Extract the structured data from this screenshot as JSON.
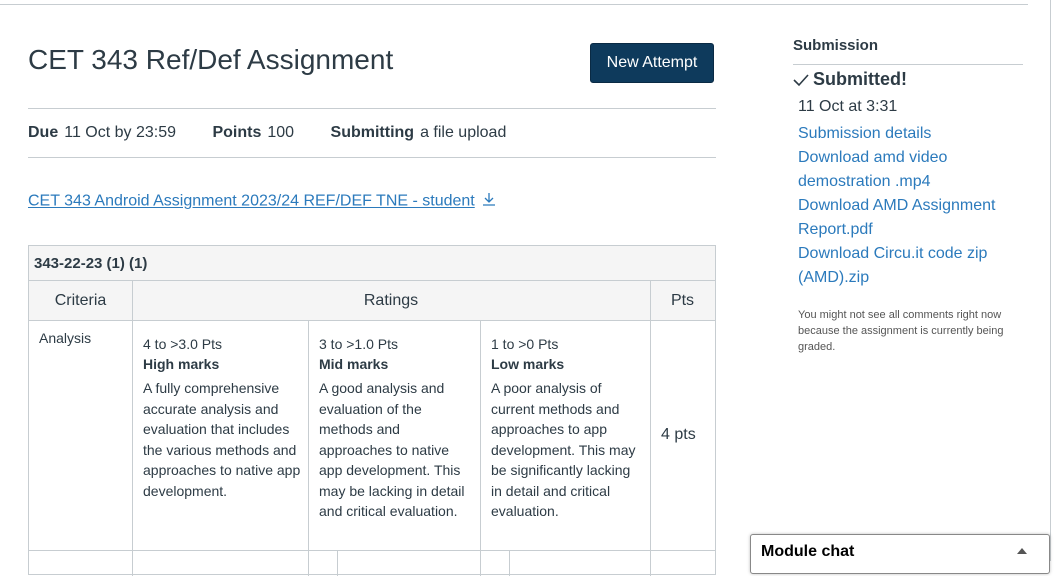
{
  "assignment": {
    "title": "CET 343 Ref/Def Assignment",
    "new_attempt_label": "New Attempt",
    "due_label": "Due",
    "due_value": "11 Oct by 23:59",
    "points_label": "Points",
    "points_value": "100",
    "submitting_label": "Submitting",
    "submitting_value": "a file upload",
    "file_link": "CET 343 Android Assignment 2023/24  REF/DEF TNE - student",
    "file_link_icon": "download-icon"
  },
  "rubric": {
    "title": "343-22-23 (1) (1)",
    "headers": {
      "criteria": "Criteria",
      "ratings": "Ratings",
      "pts": "Pts"
    },
    "criterion": {
      "name": "Analysis",
      "ratings": [
        {
          "points": "4 to >3.0 Pts",
          "label": "High marks",
          "description": "A fully comprehensive accurate analysis and evaluation that includes the various methods and approaches to native app development."
        },
        {
          "points": "3 to >1.0 Pts",
          "label": "Mid marks",
          "description": "A good analysis and evaluation of the methods and approaches to native app development. This may be lacking in detail and critical evaluation."
        },
        {
          "points": "1 to >0 Pts",
          "label": "Low marks",
          "description": "A poor analysis of current methods and approaches to app development. This may be significantly lacking in detail and critical evaluation."
        }
      ],
      "pts": "4 pts"
    }
  },
  "sidebar": {
    "heading": "Submission",
    "status": "Submitted!",
    "status_icon": "checkmark-icon",
    "date": "11 Oct at 3:31",
    "links": [
      "Submission details",
      "Download amd video demostration .mp4",
      "Download AMD Assignment Report.pdf",
      "Download Circu.it code zip (AMD).zip"
    ],
    "note": "You might not see all comments right now because the assignment is currently being graded."
  },
  "chat": {
    "title": "Module chat",
    "toggle_icon": "caret-up-icon"
  },
  "colors": {
    "primary_button": "#0e3a5c",
    "link": "#2b7abc",
    "text": "#2d3b45",
    "border": "#c7cdd1"
  }
}
